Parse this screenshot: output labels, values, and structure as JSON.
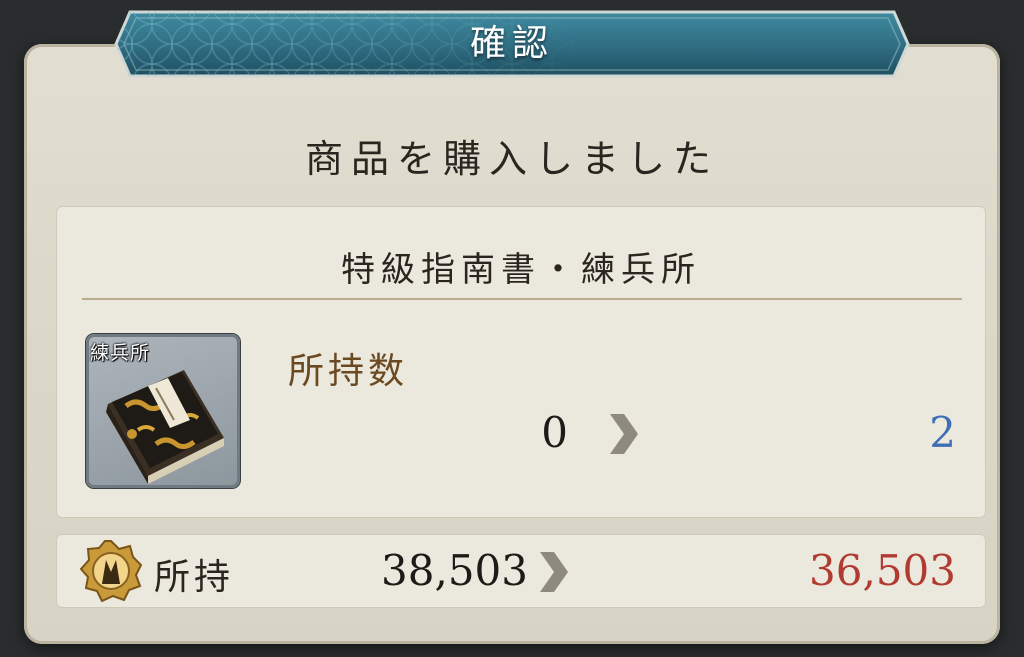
{
  "dialog": {
    "title": "確認",
    "message": "商品を購入しました"
  },
  "item": {
    "name": "特級指南書・練兵所",
    "icon": "manual-book-icon",
    "icon_label": "練兵所",
    "owned_label": "所持数",
    "owned_before": "0",
    "owned_after": "2"
  },
  "currency": {
    "icon": "koban-coin-icon",
    "label": "所持",
    "before": "38,503",
    "after": "36,503"
  },
  "colors": {
    "banner": "#2f6d82",
    "owned_after": "#3e6fb5",
    "currency_after": "#b13a31",
    "owned_label": "#6b4a22"
  }
}
